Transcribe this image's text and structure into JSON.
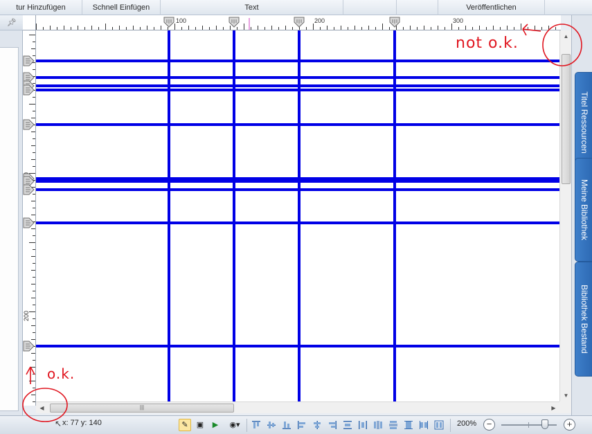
{
  "ribbon": {
    "groups": [
      {
        "label": "tur Hinzufügen"
      },
      {
        "label": "Schnell Einfügen"
      },
      {
        "label": "Text"
      },
      {
        "label": "Veröffentlichen"
      }
    ]
  },
  "left_panel": {
    "pin_icon": "pin-icon"
  },
  "ruler": {
    "h_labels": [
      "100",
      "200",
      "300"
    ],
    "v_labels": [
      "100",
      "200"
    ]
  },
  "guides": {
    "vertical_at": [
      96,
      143,
      190,
      259
    ],
    "horizontal_at": [
      19,
      31,
      37,
      40,
      65,
      104,
      106,
      112,
      136,
      225
    ]
  },
  "annotations": {
    "not_ok": "not o.k.",
    "ok": "o.k."
  },
  "right_tabs": [
    "Titel Ressourcen",
    "Meine Bibliothek",
    "Bibliothek Bestand"
  ],
  "status": {
    "coords": "x: 77 y: 140",
    "zoom": "200%",
    "zoom_level": 0.72
  },
  "colors": {
    "guide": "#0000e6",
    "annotation": "#e0151f",
    "tab": "#2f6db6"
  }
}
